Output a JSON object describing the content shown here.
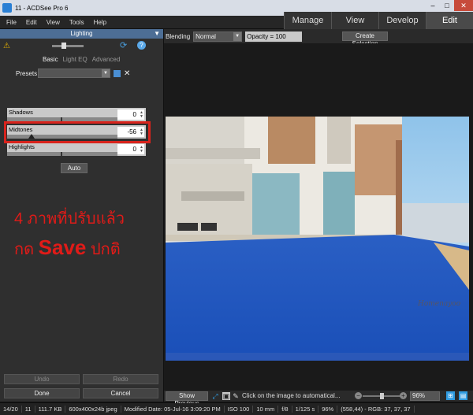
{
  "window": {
    "title": "11 - ACDSee Pro 6"
  },
  "menu": [
    "File",
    "Edit",
    "View",
    "Tools",
    "Help"
  ],
  "modes": {
    "tabs": [
      "Manage",
      "View",
      "Develop",
      "Edit"
    ],
    "active": "Edit"
  },
  "panel": {
    "title": "Lighting",
    "subtabs": [
      "Basic",
      "Light EQ",
      "Advanced"
    ],
    "active_subtab": "Basic",
    "presets_label": "Presets",
    "presets_value": "",
    "sliders": [
      {
        "label": "Shadows",
        "value": 0
      },
      {
        "label": "Midtones",
        "value": -56
      },
      {
        "label": "Highlights",
        "value": 0
      }
    ],
    "auto_label": "Auto",
    "undo_label": "Undo",
    "redo_label": "Redo",
    "done_label": "Done",
    "cancel_label": "Cancel"
  },
  "overlay": {
    "line1": "4 ภาพที่ปรับแล้ว",
    "line2_prefix": "กด ",
    "line2_bold": "Save",
    "line2_suffix": " ปกติ"
  },
  "toolbar": {
    "blending_label": "Blending",
    "blending_value": "Normal",
    "opacity_text": "Opacity = 100",
    "create_selection_label": "Create Selection"
  },
  "photo": {
    "watermark": "Homenayoo"
  },
  "viewer_bar": {
    "show_previous_label": "Show Previous",
    "message": "Click on the image to automatical...",
    "zoom": "96%"
  },
  "statusbar": [
    "14/20",
    "11",
    "111.7 KB",
    "600x400x24b jpeg",
    "Modified Date: 05-Jul-16 3:09:20 PM",
    "ISO 100",
    "10 mm",
    "f/8",
    "1/125 s",
    "96%",
    "(558,44) - RGB: 37, 37, 37"
  ],
  "colors": {
    "accent": "#4d6e95",
    "highlight_box": "#d8231c",
    "overlay_text": "#e01b18"
  }
}
